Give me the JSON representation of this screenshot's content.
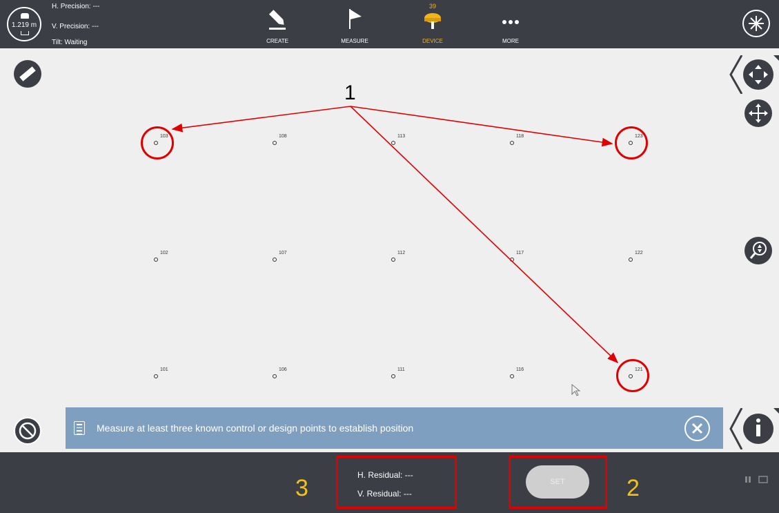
{
  "status": {
    "antenna_height": "1.219 m",
    "h_precision": "H. Precision:  ---",
    "v_precision": "V. Precision:  ---",
    "tilt": "Tilt:  Waiting"
  },
  "toolbar": {
    "create": "CREATE",
    "measure": "MEASURE",
    "device": "DEVICE",
    "device_badge": "39",
    "more": "MORE",
    "active": "DEVICE"
  },
  "points": [
    {
      "id": "103"
    },
    {
      "id": "108"
    },
    {
      "id": "113"
    },
    {
      "id": "118"
    },
    {
      "id": "123"
    },
    {
      "id": "102"
    },
    {
      "id": "107"
    },
    {
      "id": "112"
    },
    {
      "id": "117"
    },
    {
      "id": "122"
    },
    {
      "id": "101"
    },
    {
      "id": "106"
    },
    {
      "id": "111"
    },
    {
      "id": "116"
    },
    {
      "id": "121"
    }
  ],
  "highlighted_points": [
    "103",
    "123",
    "121"
  ],
  "banner": {
    "message": "Measure at least three known control or design points to establish position"
  },
  "residuals": {
    "h": "H. Residual:  ---",
    "v": "V. Residual:  ---"
  },
  "set_label": "SET",
  "callouts": {
    "one": "1",
    "two": "2",
    "three": "3"
  },
  "colors": {
    "bar": "#3c3e46",
    "accent": "#f2b51c",
    "banner": "#7f9fc1",
    "highlight": "#e00000"
  }
}
